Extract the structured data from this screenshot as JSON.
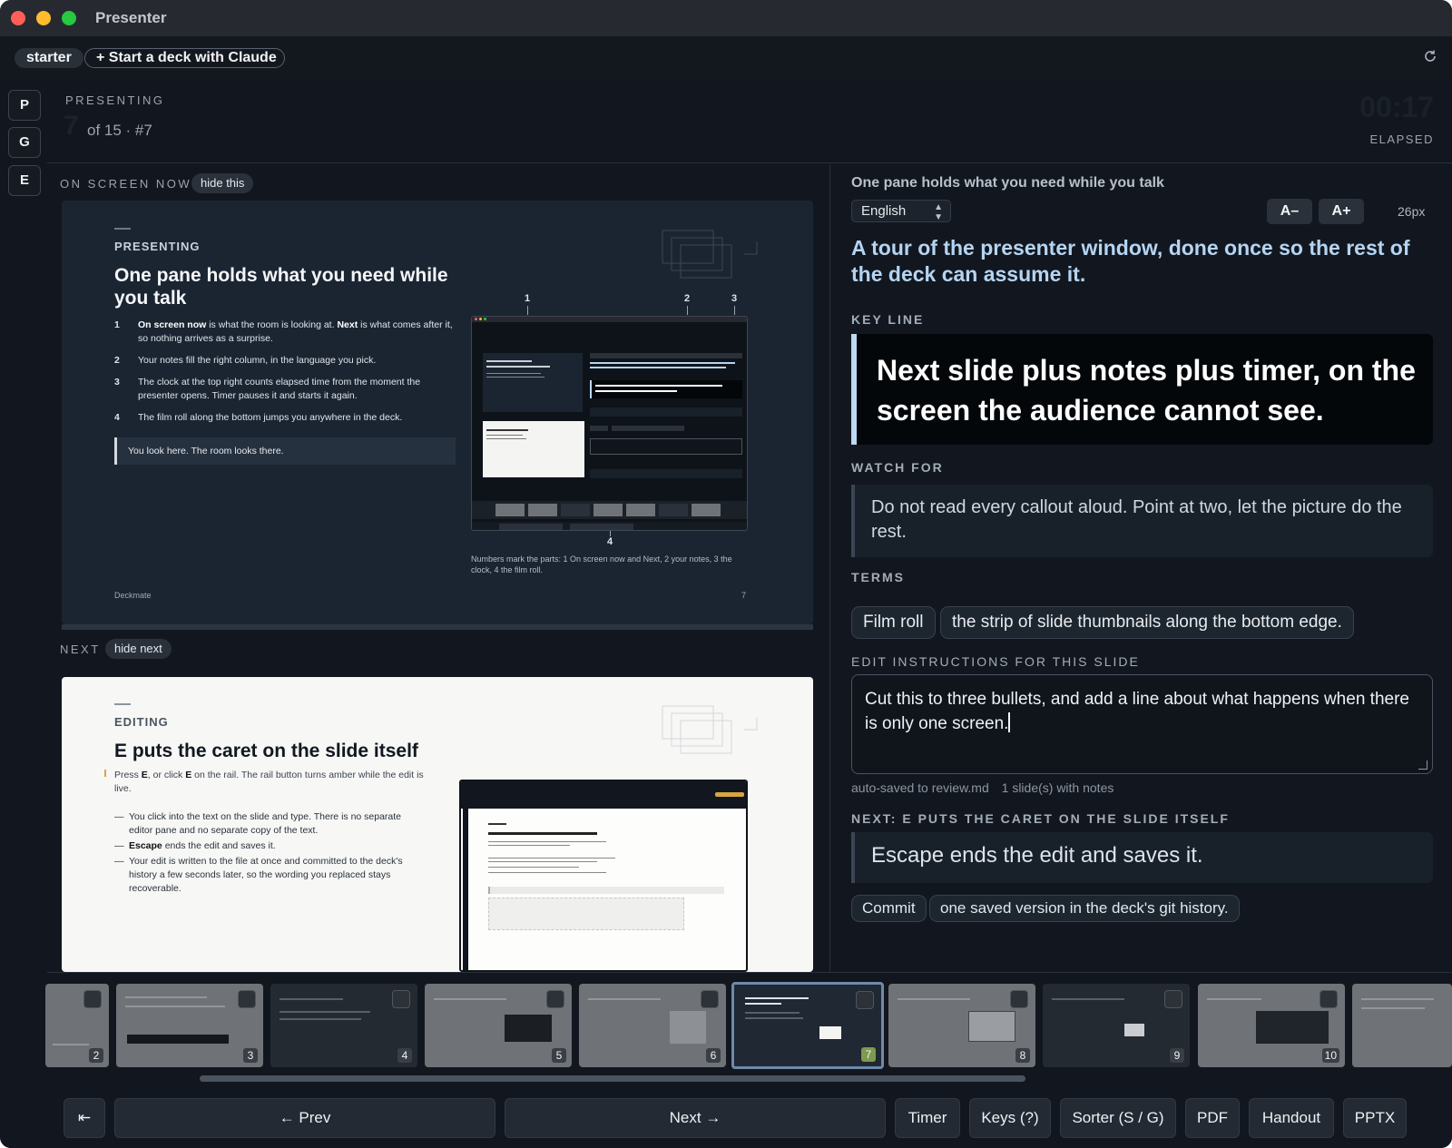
{
  "app": {
    "title": "Presenter"
  },
  "tabs": {
    "active": "starter",
    "new_deck": "+ Start a deck with Claude"
  },
  "rail": [
    "P",
    "G",
    "E"
  ],
  "header": {
    "mode": "PRESENTING",
    "slide_number": "7",
    "position": "of 15 · #7",
    "timer": "00:17",
    "timer_label": "ELAPSED"
  },
  "current": {
    "label": "ON SCREEN NOW",
    "hide": "hide this",
    "slide": {
      "kicker": "PRESENTING",
      "title": "One pane holds what you need while you talk",
      "items": [
        {
          "n": "1",
          "bold1": "On screen now",
          "t1": " is what the room is looking at. ",
          "bold2": "Next",
          "t2": " is what comes after it, so nothing arrives as a surprise."
        },
        {
          "n": "2",
          "text": "Your notes fill the right column, in the language you pick."
        },
        {
          "n": "3",
          "text": "The clock at the top right counts elapsed time from the moment the presenter opens. Timer pauses it and starts it again."
        },
        {
          "n": "4",
          "text": "The film roll along the bottom jumps you anywhere in the deck."
        }
      ],
      "callout": "You look here. The room looks there.",
      "markers": [
        "1",
        "2",
        "3",
        "4"
      ],
      "caption": "Numbers mark the parts: 1 On screen now and Next, 2 your notes, 3 the clock, 4 the film roll.",
      "footer": "Deckmate",
      "page": "7"
    }
  },
  "next": {
    "label": "NEXT",
    "hide": "hide next",
    "slide": {
      "kicker": "EDITING",
      "title": "E puts the caret on the slide itself",
      "intro": {
        "t1": "Press ",
        "b1": "E",
        "t2": ", or click ",
        "b2": "E",
        "t3": " on the rail. The rail button turns amber while the edit is live."
      },
      "items": [
        {
          "text": "You click into the text on the slide and type. There is no separate editor pane and no separate copy of the text."
        },
        {
          "bold": "Escape",
          "text": " ends the edit and saves it."
        },
        {
          "text": "Your edit is written to the file at once and committed to the deck's history a few seconds later, so the wording you replaced stays recoverable."
        }
      ]
    }
  },
  "notes": {
    "heading": "One pane holds what you need while you talk",
    "language": "English",
    "font_down": "A–",
    "font_up": "A+",
    "font_size": "26px",
    "lead": "A tour of the presenter window, done once so the rest of the deck can assume it.",
    "key_line_label": "KEY LINE",
    "key_line": "Next slide plus notes plus timer, on the screen the audience cannot see.",
    "watch_label": "WATCH FOR",
    "watch": "Do not read every callout aloud. Point at two, let the picture do the rest.",
    "terms_label": "TERMS",
    "terms": {
      "term": "Film roll",
      "definition": "the strip of slide thumbnails along the bottom edge."
    },
    "edit_label": "EDIT INSTRUCTIONS FOR THIS SLIDE",
    "edit_text": "Cut this to three bullets, and add a line about what happens when there is only one screen.",
    "saved": "auto-saved to review.md",
    "notes_count": "1 slide(s) with notes",
    "next_label": "NEXT: E PUTS THE CARET ON THE SLIDE ITSELF",
    "next_line": "Escape ends the edit and saves it.",
    "next_terms": {
      "term": "Commit",
      "definition": "one saved version in the deck's git history."
    }
  },
  "film_roll": {
    "active": "7",
    "thumbs": [
      "2",
      "3",
      "4",
      "5",
      "6",
      "7",
      "8",
      "9",
      "10"
    ]
  },
  "toolbar": {
    "first": "⇤",
    "prev": "← Prev",
    "next": "Next →",
    "timer": "Timer",
    "keys": "Keys (?)",
    "sorter": "Sorter (S / G)",
    "pdf": "PDF",
    "handout": "Handout",
    "pptx": "PPTX"
  }
}
